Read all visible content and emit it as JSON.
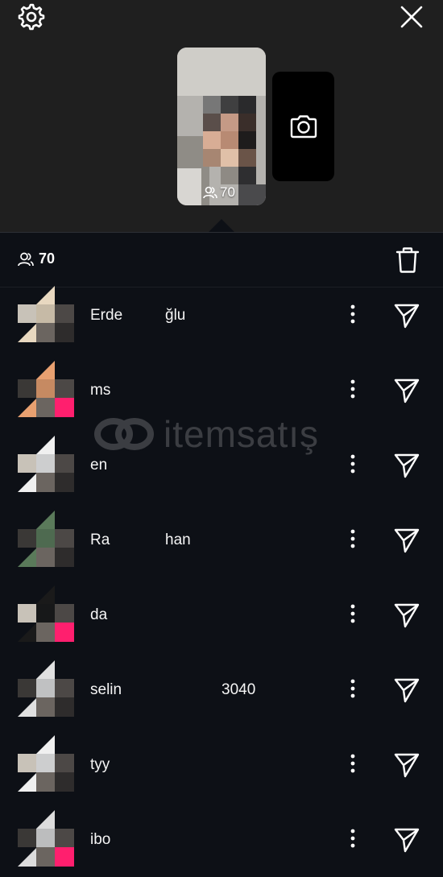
{
  "story": {
    "viewer_count": "70"
  },
  "viewers": {
    "count": "70",
    "list": [
      {
        "name_start": "Erde",
        "name_end": "ğlu",
        "avatar_color": "#e8d8c0"
      },
      {
        "name_start": "ms",
        "name_end": "",
        "avatar_color": "#e8a070"
      },
      {
        "name_start": "en",
        "name_end": "",
        "avatar_color": "#f0f0f0"
      },
      {
        "name_start": "Ra",
        "name_end": "han",
        "avatar_color": "#5a7a5a"
      },
      {
        "name_start": "da",
        "name_end": "",
        "avatar_color": "#1a1a1a"
      },
      {
        "name_start": "selin",
        "name_end": "3040",
        "avatar_color": "#e0e0e0"
      },
      {
        "name_start": "tyy",
        "name_end": "",
        "avatar_color": "#f0f0f0"
      },
      {
        "name_start": "ibo",
        "name_end": "",
        "avatar_color": "#dcdcdc"
      }
    ]
  },
  "watermark": {
    "text": "itemsatış"
  },
  "colors": {
    "background": "#0d1016",
    "top_panel": "#1f1f1f",
    "accent_pink": "#ff1f6e"
  }
}
